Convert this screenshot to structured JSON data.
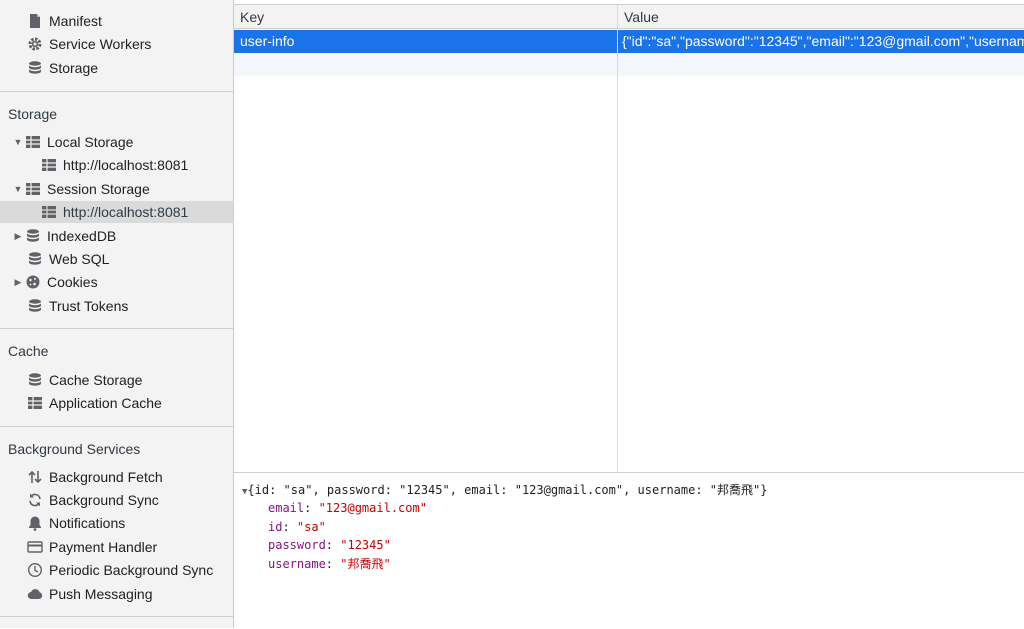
{
  "sidebar": {
    "top_items": [
      {
        "label": "Manifest",
        "icon": "document-icon"
      },
      {
        "label": "Service Workers",
        "icon": "gear-icon"
      },
      {
        "label": "Storage",
        "icon": "database-icon"
      }
    ],
    "storage": {
      "title": "Storage",
      "items": [
        {
          "label": "Local Storage",
          "icon": "grid-icon",
          "arrow": "expanded"
        },
        {
          "label": "http://localhost:8081",
          "icon": "grid-icon",
          "child": true
        },
        {
          "label": "Session Storage",
          "icon": "grid-icon",
          "arrow": "expanded"
        },
        {
          "label": "http://localhost:8081",
          "icon": "grid-icon",
          "child": true,
          "selected": true
        },
        {
          "label": "IndexedDB",
          "icon": "database-icon",
          "arrow": "collapsed"
        },
        {
          "label": "Web SQL",
          "icon": "database-icon"
        },
        {
          "label": "Cookies",
          "icon": "cookie-icon",
          "arrow": "collapsed"
        },
        {
          "label": "Trust Tokens",
          "icon": "database-icon"
        }
      ]
    },
    "cache": {
      "title": "Cache",
      "items": [
        {
          "label": "Cache Storage",
          "icon": "database-icon"
        },
        {
          "label": "Application Cache",
          "icon": "grid-icon"
        }
      ]
    },
    "background": {
      "title": "Background Services",
      "items": [
        {
          "label": "Background Fetch",
          "icon": "up-down-arrows-icon"
        },
        {
          "label": "Background Sync",
          "icon": "sync-icon"
        },
        {
          "label": "Notifications",
          "icon": "bell-icon"
        },
        {
          "label": "Payment Handler",
          "icon": "card-icon"
        },
        {
          "label": "Periodic Background Sync",
          "icon": "clock-icon"
        },
        {
          "label": "Push Messaging",
          "icon": "cloud-icon"
        }
      ]
    }
  },
  "table": {
    "headers": {
      "key": "Key",
      "value": "Value"
    },
    "rows": [
      {
        "key": "user-info",
        "value": "{\"id\":\"sa\",\"password\":\"12345\",\"email\":\"123@gmail.com\",\"username\":\"邦喬飛\"}",
        "selected": true
      }
    ]
  },
  "preview": {
    "summary": "{id: \"sa\", password: \"12345\", email: \"123@gmail.com\", username: \"邦喬飛\"}",
    "props": [
      {
        "key": "email",
        "value": "\"123@gmail.com\""
      },
      {
        "key": "id",
        "value": "\"sa\""
      },
      {
        "key": "password",
        "value": "\"12345\""
      },
      {
        "key": "username",
        "value": "\"邦喬飛\""
      }
    ]
  },
  "colors": {
    "selection": "#1a73e8",
    "key_purple": "#881280",
    "string_red": "#c80000"
  }
}
